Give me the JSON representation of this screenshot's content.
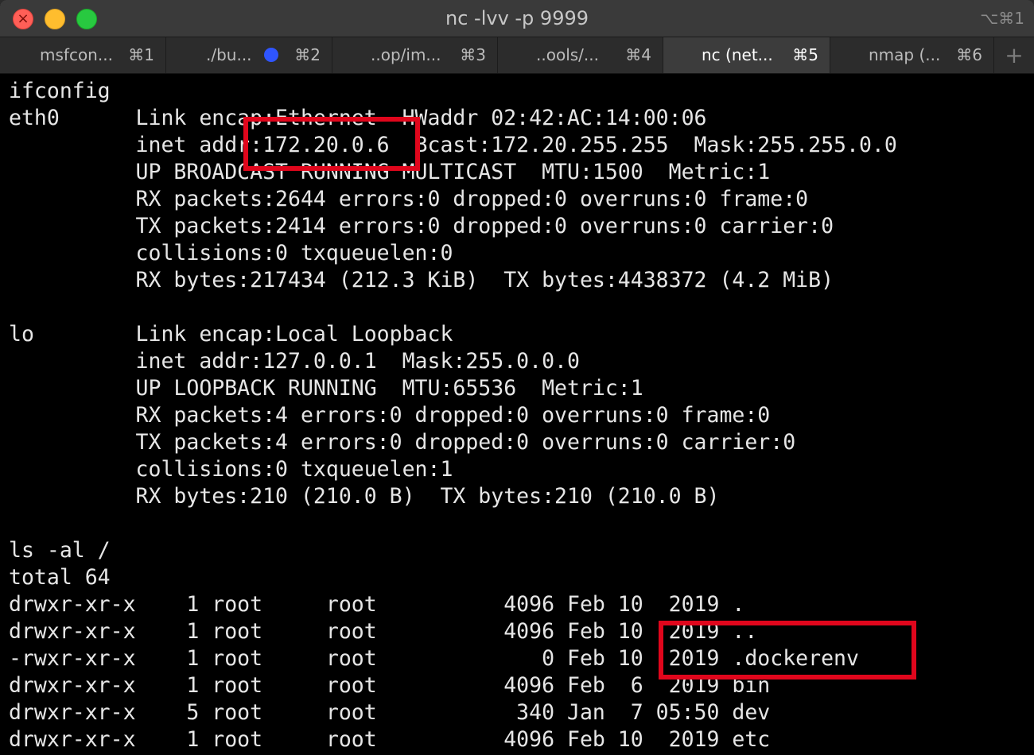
{
  "window": {
    "title": "nc -lvv -p 9999",
    "shortcut": "⌥⌘1"
  },
  "tabs": [
    {
      "label": "msfcon...",
      "shortcut": "⌘1",
      "active": false
    },
    {
      "label": "./bu...",
      "shortcut": "⌘2",
      "active": false,
      "activity": true
    },
    {
      "label": "..op/im...",
      "shortcut": "⌘3",
      "active": false
    },
    {
      "label": "..ools/...",
      "shortcut": "⌘4",
      "active": false
    },
    {
      "label": "nc (net...",
      "shortcut": "⌘5",
      "active": true
    },
    {
      "label": "nmap (...",
      "shortcut": "⌘6",
      "active": false
    }
  ],
  "new_tab": "+",
  "colors": {
    "highlight": "#e0061c",
    "activity_dot": "#2f55ff",
    "terminal_bg": "#000000",
    "terminal_fg": "#e6e6e6"
  },
  "terminal": {
    "lines": [
      "ifconfig",
      "eth0      Link encap:Ethernet  HWaddr 02:42:AC:14:00:06",
      "          inet addr:172.20.0.6  Bcast:172.20.255.255  Mask:255.255.0.0",
      "          UP BROADCAST RUNNING MULTICAST  MTU:1500  Metric:1",
      "          RX packets:2644 errors:0 dropped:0 overruns:0 frame:0",
      "          TX packets:2414 errors:0 dropped:0 overruns:0 carrier:0",
      "          collisions:0 txqueuelen:0",
      "          RX bytes:217434 (212.3 KiB)  TX bytes:4438372 (4.2 MiB)",
      "",
      "lo        Link encap:Local Loopback",
      "          inet addr:127.0.0.1  Mask:255.0.0.0",
      "          UP LOOPBACK RUNNING  MTU:65536  Metric:1",
      "          RX packets:4 errors:0 dropped:0 overruns:0 frame:0",
      "          TX packets:4 errors:0 dropped:0 overruns:0 carrier:0",
      "          collisions:0 txqueuelen:1",
      "          RX bytes:210 (210.0 B)  TX bytes:210 (210.0 B)",
      "",
      "ls -al /",
      "total 64",
      "drwxr-xr-x    1 root     root          4096 Feb 10  2019 .",
      "drwxr-xr-x    1 root     root          4096 Feb 10  2019 ..",
      "-rwxr-xr-x    1 root     root             0 Feb 10  2019 .dockerenv",
      "drwxr-xr-x    1 root     root          4096 Feb  6  2019 bin",
      "drwxr-xr-x    5 root     root           340 Jan  7 05:50 dev",
      "drwxr-xr-x    1 root     root          4096 Feb 10  2019 etc"
    ]
  }
}
